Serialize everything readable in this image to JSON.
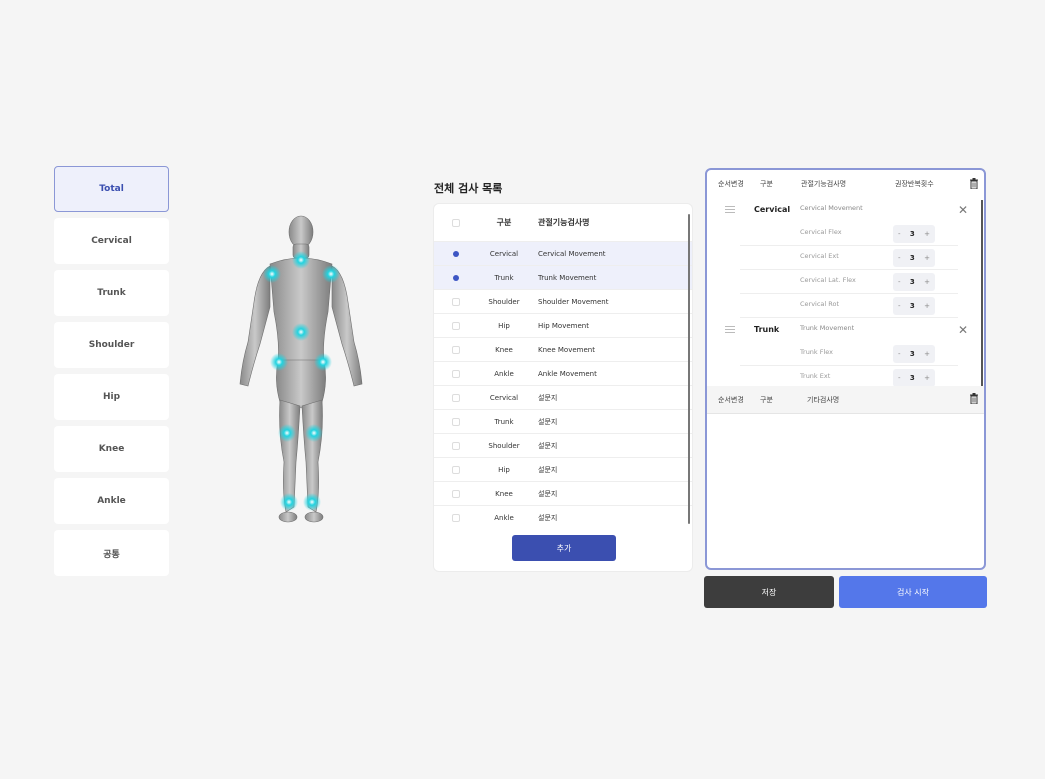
{
  "sidebar": {
    "items": [
      {
        "label": "Total"
      },
      {
        "label": "Cervical"
      },
      {
        "label": "Trunk"
      },
      {
        "label": "Shoulder"
      },
      {
        "label": "Hip"
      },
      {
        "label": "Knee"
      },
      {
        "label": "Ankle"
      },
      {
        "label": "공통"
      }
    ]
  },
  "test_list": {
    "title": "전체 검사 목록",
    "col_part": "구분",
    "col_name": "관절기능검사명",
    "rows": [
      {
        "part": "Cervical",
        "name": "Cervical Movement",
        "checked": true
      },
      {
        "part": "Trunk",
        "name": "Trunk Movement",
        "checked": true
      },
      {
        "part": "Shoulder",
        "name": "Shoulder Movement",
        "checked": false
      },
      {
        "part": "Hip",
        "name": "Hip Movement",
        "checked": false
      },
      {
        "part": "Knee",
        "name": "Knee Movement",
        "checked": false
      },
      {
        "part": "Ankle",
        "name": "Ankle Movement",
        "checked": false
      },
      {
        "part": "Cervical",
        "name": "설문지",
        "checked": false
      },
      {
        "part": "Trunk",
        "name": "설문지",
        "checked": false
      },
      {
        "part": "Shoulder",
        "name": "설문지",
        "checked": false
      },
      {
        "part": "Hip",
        "name": "설문지",
        "checked": false
      },
      {
        "part": "Knee",
        "name": "설문지",
        "checked": false
      },
      {
        "part": "Ankle",
        "name": "설문지",
        "checked": false
      }
    ],
    "add_label": "추가"
  },
  "selected": {
    "col_order": "순서변경",
    "col_part": "구분",
    "col_name": "관절기능검사명",
    "col_reps": "권장반복횟수",
    "groups": [
      {
        "part": "Cervical",
        "name": "Cervical Movement",
        "subs": [
          {
            "name": "Cervical Flex",
            "reps": "3"
          },
          {
            "name": "Cervical Ext",
            "reps": "3"
          },
          {
            "name": "Cervical Lat. Flex",
            "reps": "3"
          },
          {
            "name": "Cervical Rot",
            "reps": "3"
          }
        ]
      },
      {
        "part": "Trunk",
        "name": "Trunk Movement",
        "subs": [
          {
            "name": "Trunk Flex",
            "reps": "3"
          },
          {
            "name": "Trunk Ext",
            "reps": "3"
          }
        ]
      }
    ],
    "other": {
      "col_order": "순서변경",
      "col_part": "구분",
      "col_name": "기타검사명"
    }
  },
  "stepper": {
    "minus": "-",
    "plus": "+"
  },
  "close_glyph": "✕",
  "buttons": {
    "save": "저장",
    "start": "검사 시작"
  },
  "colors": {
    "accent": "#3b4fb0",
    "start": "#5477ea",
    "save": "#3d3d3d",
    "joint": "#22d3e0"
  }
}
